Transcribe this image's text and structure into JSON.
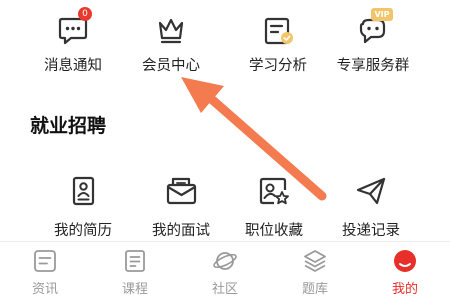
{
  "top_grid": {
    "items": [
      {
        "label": "消息通知",
        "icon": "message-icon",
        "badge": "0"
      },
      {
        "label": "会员中心",
        "icon": "crown-icon"
      },
      {
        "label": "学习分析",
        "icon": "analysis-icon"
      },
      {
        "label": "专享服务群",
        "icon": "chat-group-icon",
        "badge": "VIP"
      }
    ]
  },
  "job_section": {
    "title": "就业招聘",
    "items": [
      {
        "label": "我的简历",
        "icon": "resume-icon"
      },
      {
        "label": "我的面试",
        "icon": "interview-icon"
      },
      {
        "label": "职位收藏",
        "icon": "favorite-job-icon"
      },
      {
        "label": "投递记录",
        "icon": "send-record-icon"
      }
    ]
  },
  "tabbar": {
    "tabs": [
      {
        "label": "资讯",
        "icon": "news-icon"
      },
      {
        "label": "课程",
        "icon": "course-icon"
      },
      {
        "label": "社区",
        "icon": "community-icon"
      },
      {
        "label": "题库",
        "icon": "question-bank-icon"
      },
      {
        "label": "我的",
        "icon": "profile-icon",
        "active": true
      }
    ]
  },
  "colors": {
    "accent": "#e8302a",
    "badge": "#e83a2f",
    "vip": "#f2c56a",
    "annotation_arrow": "#f47a4f",
    "icon_stroke": "#333333",
    "tab_inactive": "#9a9a9a"
  }
}
